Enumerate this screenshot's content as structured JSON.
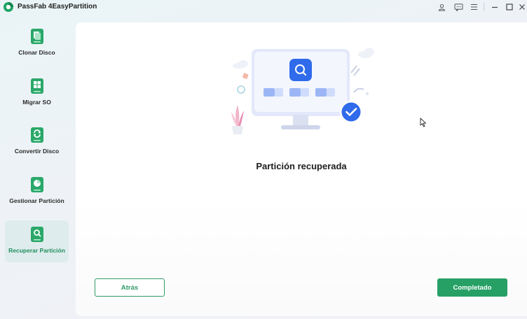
{
  "app": {
    "title": "PassFab 4EasyPartition",
    "brand_color": "#27a065"
  },
  "titlebar": {
    "icons": [
      "user-icon",
      "feedback-icon",
      "menu-icon",
      "minimize-icon",
      "maximize-icon",
      "close-icon"
    ]
  },
  "sidebar": {
    "items": [
      {
        "label": "Clonar Disco",
        "icon": "clone-disk-icon",
        "active": false
      },
      {
        "label": "Migrar SO",
        "icon": "migrate-os-icon",
        "active": false
      },
      {
        "label": "Convertir Disco",
        "icon": "convert-disk-icon",
        "active": false
      },
      {
        "label": "Gestionar Partición",
        "icon": "manage-partition-icon",
        "active": false
      },
      {
        "label": "Recuperar Partición",
        "icon": "recover-partition-icon",
        "active": true
      }
    ]
  },
  "main": {
    "status_text": "Partición recuperada",
    "back_label": "Atrás",
    "done_label": "Completado"
  }
}
